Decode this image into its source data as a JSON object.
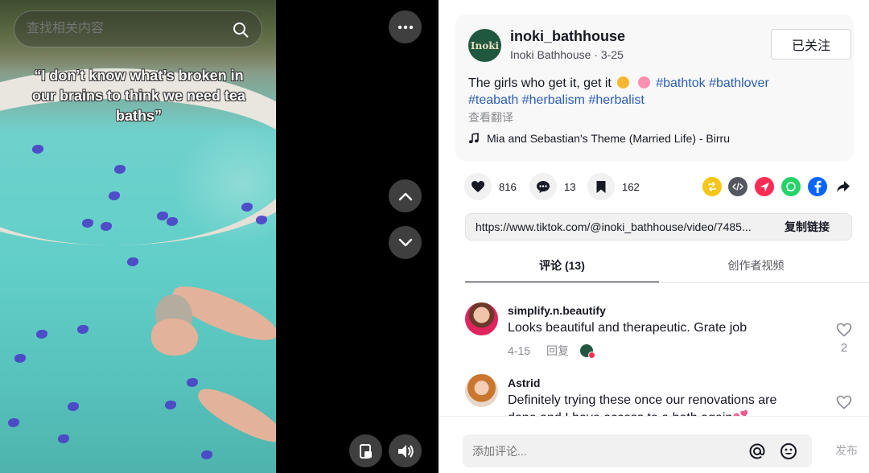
{
  "search": {
    "placeholder": "查找相关内容"
  },
  "video": {
    "caption": "“I don’t know what’s broken in our brains to think we need tea baths”"
  },
  "post": {
    "author_handle": "inoki_bathhouse",
    "author_name": "Inoki Bathhouse",
    "date": "3-25",
    "meta": "Inoki Bathhouse · 3-25",
    "avatar_text": "Inoki",
    "follow_label": "已关注",
    "description_text": "The girls who get it, get it",
    "hashtags": [
      "#bathtok",
      "#bathlover",
      "#teabath",
      "#herbalism",
      "#herbalist"
    ],
    "translate_label": "查看翻译",
    "music": "Mia and Sebastian's Theme (Married Life) - Birru"
  },
  "stats": {
    "likes": "816",
    "comments": "13",
    "saves": "162"
  },
  "share": {
    "icons": [
      "repost-icon",
      "embed-icon",
      "send-icon",
      "whatsapp-icon",
      "facebook-icon",
      "share-arrow-icon"
    ],
    "colors": {
      "repost": "#f5c518",
      "embed": "#54575f",
      "send": "#fe2c55",
      "whatsapp": "#25d366",
      "facebook": "#0866ff"
    }
  },
  "link": {
    "url": "https://www.tiktok.com/@inoki_bathhouse/video/7485...",
    "copy_label": "复制链接"
  },
  "tabs": {
    "comments": "评论 (13)",
    "creator_videos": "创作者视频"
  },
  "comments": [
    {
      "user": "simplify.n.beautify",
      "text": "Looks beautiful and therapeutic. Grate job",
      "date": "4-15",
      "reply_label": "回复",
      "likes": "2"
    },
    {
      "user": "Astrid",
      "text": "Definitely trying these once our renovations are done and I have access to a bath again💕",
      "likes": ""
    }
  ],
  "composer": {
    "placeholder": "添加评论...",
    "post_label": "发布"
  },
  "colors": {
    "hashtag": "#2b5db5",
    "brand_green": "#20573f",
    "accent_red": "#fe2c55"
  }
}
